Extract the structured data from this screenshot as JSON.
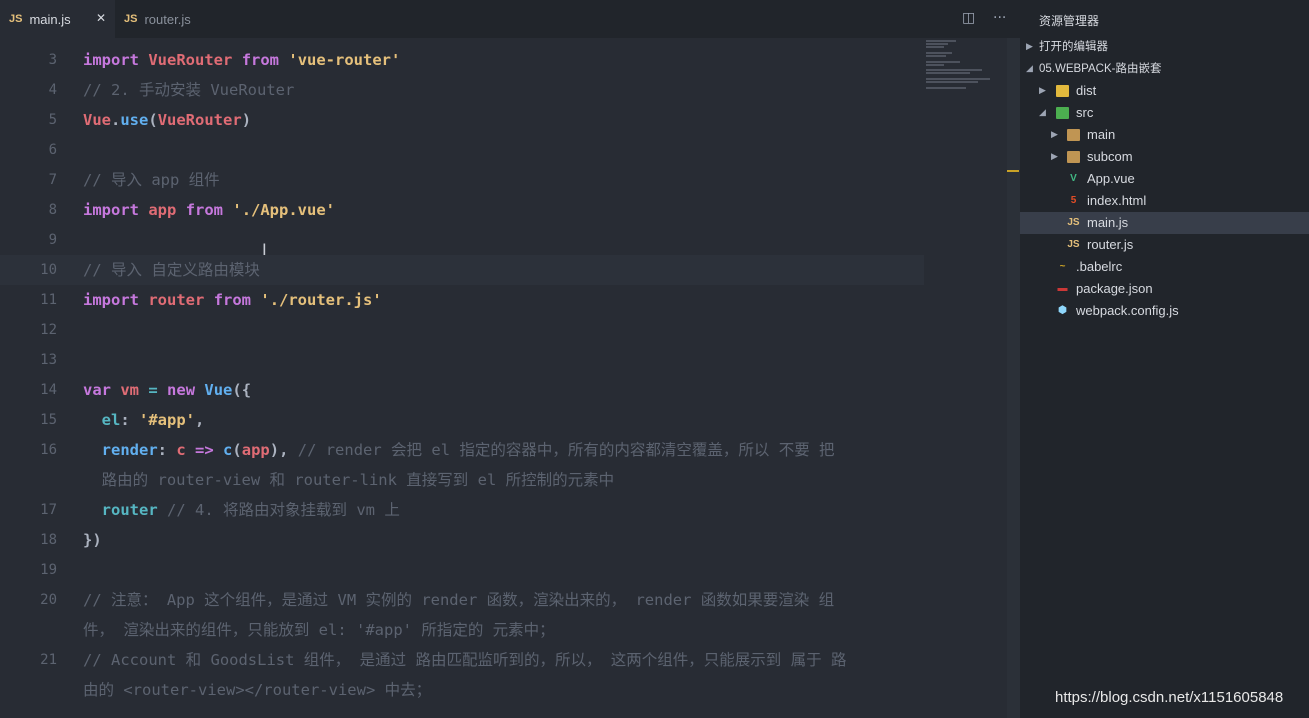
{
  "tabs": [
    {
      "icon": "JS",
      "label": "main.js",
      "close": "✕"
    },
    {
      "icon": "JS",
      "label": "router.js"
    }
  ],
  "toolbar": {
    "split_icon": "split-editor-icon",
    "more_icon": "more-icon"
  },
  "code": {
    "lines": [
      {
        "n": "3",
        "tokens": [
          [
            "kw",
            "import"
          ],
          [
            "pl",
            " "
          ],
          [
            "var",
            "VueRouter"
          ],
          [
            "pl",
            " "
          ],
          [
            "kw",
            "from"
          ],
          [
            "pl",
            " "
          ],
          [
            "str",
            "'vue-router'"
          ]
        ]
      },
      {
        "n": "4",
        "tokens": [
          [
            "cm",
            "// 2. 手动安装 VueRouter"
          ]
        ]
      },
      {
        "n": "5",
        "tokens": [
          [
            "var",
            "Vue"
          ],
          [
            "pl",
            "."
          ],
          [
            "fn",
            "use"
          ],
          [
            "pl",
            "("
          ],
          [
            "var",
            "VueRouter"
          ],
          [
            "pl",
            ")"
          ]
        ]
      },
      {
        "n": "6",
        "tokens": []
      },
      {
        "n": "7",
        "tokens": [
          [
            "cm",
            "// 导入 app 组件"
          ]
        ]
      },
      {
        "n": "8",
        "tokens": [
          [
            "kw",
            "import"
          ],
          [
            "pl",
            " "
          ],
          [
            "var",
            "app"
          ],
          [
            "pl",
            " "
          ],
          [
            "kw",
            "from"
          ],
          [
            "pl",
            " "
          ],
          [
            "str",
            "'./App.vue'"
          ]
        ]
      },
      {
        "n": "9",
        "tokens": []
      },
      {
        "n": "10",
        "tokens": [
          [
            "cm",
            "// 导入 自定义路由模块"
          ]
        ],
        "hl": true
      },
      {
        "n": "11",
        "tokens": [
          [
            "kw",
            "import"
          ],
          [
            "pl",
            " "
          ],
          [
            "var",
            "router"
          ],
          [
            "pl",
            " "
          ],
          [
            "kw",
            "from"
          ],
          [
            "pl",
            " "
          ],
          [
            "str",
            "'./router.js'"
          ]
        ]
      },
      {
        "n": "12",
        "tokens": []
      },
      {
        "n": "13",
        "tokens": []
      },
      {
        "n": "14",
        "tokens": [
          [
            "kw",
            "var"
          ],
          [
            "pl",
            " "
          ],
          [
            "var",
            "vm"
          ],
          [
            "pl",
            " "
          ],
          [
            "op",
            "="
          ],
          [
            "pl",
            " "
          ],
          [
            "kw",
            "new"
          ],
          [
            "pl",
            " "
          ],
          [
            "fn",
            "Vue"
          ],
          [
            "pl",
            "({"
          ]
        ]
      },
      {
        "n": "15",
        "tokens": [
          [
            "pl",
            "  "
          ],
          [
            "prop",
            "el"
          ],
          [
            "pl",
            ": "
          ],
          [
            "str",
            "'#app'"
          ],
          [
            "pl",
            ","
          ]
        ]
      },
      {
        "n": "16",
        "tokens": [
          [
            "pl",
            "  "
          ],
          [
            "fn",
            "render"
          ],
          [
            "pl",
            ": "
          ],
          [
            "var",
            "c"
          ],
          [
            "pl",
            " "
          ],
          [
            "kw",
            "=>"
          ],
          [
            "pl",
            " "
          ],
          [
            "fn",
            "c"
          ],
          [
            "pl",
            "("
          ],
          [
            "var",
            "app"
          ],
          [
            "pl",
            "), "
          ],
          [
            "cm",
            "// render 会把 el 指定的容器中，所有的内容都清空覆盖，所以 不要 把"
          ]
        ]
      },
      {
        "n": "",
        "tokens": [
          [
            "cm",
            "  路由的 router-view 和 router-link 直接写到 el 所控制的元素中"
          ]
        ]
      },
      {
        "n": "17",
        "tokens": [
          [
            "pl",
            "  "
          ],
          [
            "prop",
            "router"
          ],
          [
            "pl",
            " "
          ],
          [
            "cm",
            "// 4. 将路由对象挂载到 vm 上"
          ]
        ]
      },
      {
        "n": "18",
        "tokens": [
          [
            "pl",
            "})"
          ]
        ]
      },
      {
        "n": "19",
        "tokens": []
      },
      {
        "n": "20",
        "tokens": [
          [
            "cm",
            "// 注意： App 这个组件，是通过 VM 实例的 render 函数，渲染出来的， render 函数如果要渲染 组"
          ]
        ]
      },
      {
        "n": "",
        "tokens": [
          [
            "cm",
            "件， 渲染出来的组件，只能放到 el: '#app' 所指定的 元素中；"
          ]
        ]
      },
      {
        "n": "21",
        "tokens": [
          [
            "cm",
            "// Account 和 GoodsList 组件， 是通过 路由匹配监听到的，所以， 这两个组件，只能展示到 属于 路"
          ]
        ]
      },
      {
        "n": "",
        "tokens": [
          [
            "cm",
            "由的 <router-view></router-view> 中去；"
          ]
        ]
      }
    ]
  },
  "sidebar": {
    "title": "资源管理器",
    "open_editors": "打开的编辑器",
    "project": "05.WEBPACK-路由嵌套",
    "items": [
      {
        "name": "dist",
        "kind": "folder-dist",
        "depth": 1,
        "arrow": "▶"
      },
      {
        "name": "src",
        "kind": "folder-src",
        "depth": 1,
        "arrow": "◢"
      },
      {
        "name": "main",
        "kind": "folder",
        "depth": 2,
        "arrow": "▶"
      },
      {
        "name": "subcom",
        "kind": "folder",
        "depth": 2,
        "arrow": "▶"
      },
      {
        "name": "App.vue",
        "kind": "vue",
        "depth": 2,
        "glyph": "V"
      },
      {
        "name": "index.html",
        "kind": "html",
        "depth": 2,
        "glyph": "5"
      },
      {
        "name": "main.js",
        "kind": "js",
        "depth": 2,
        "glyph": "JS",
        "selected": true
      },
      {
        "name": "router.js",
        "kind": "js",
        "depth": 2,
        "glyph": "JS"
      },
      {
        "name": ".babelrc",
        "kind": "babel",
        "depth": 1,
        "glyph": "~"
      },
      {
        "name": "package.json",
        "kind": "npm",
        "depth": 1,
        "glyph": "▬"
      },
      {
        "name": "webpack.config.js",
        "kind": "webpack",
        "depth": 1,
        "glyph": "⬢"
      }
    ]
  },
  "watermark": "https://blog.csdn.net/x1151605848",
  "colors": {
    "keyword": "#c678dd",
    "variable": "#e06c75",
    "string": "#e5c07b",
    "comment": "#5c6370",
    "function": "#61afef",
    "property": "#56b6c2"
  }
}
